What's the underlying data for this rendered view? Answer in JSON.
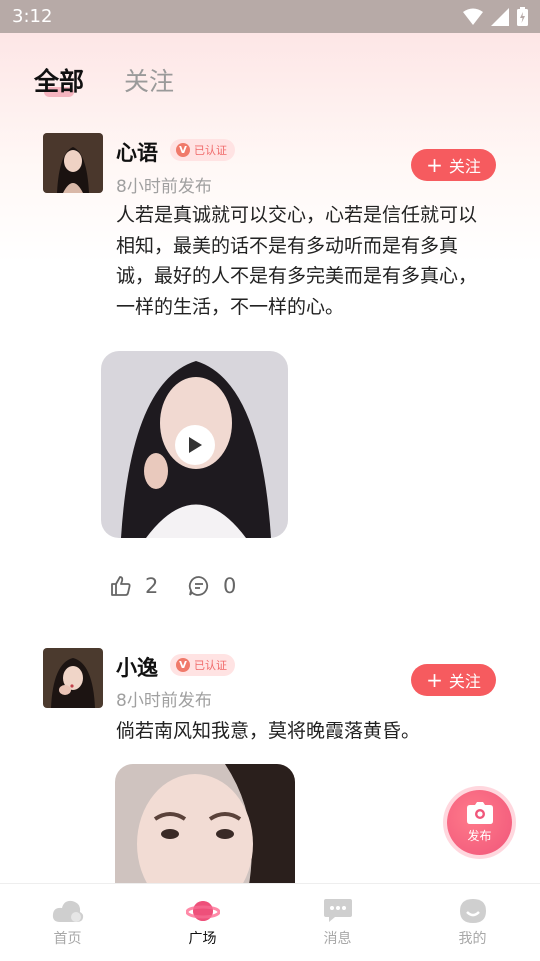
{
  "status_bar": {
    "time": "3:12"
  },
  "tabs": [
    {
      "label": "全部",
      "active": true
    },
    {
      "label": "关注",
      "active": false
    }
  ],
  "posts": [
    {
      "username": "心语",
      "badge": "已认证",
      "time": "8小时前发布",
      "follow_label": "关注",
      "content": "人若是真诚就可以交心，心若是信任就可以相知，最美的话不是有多动听而是有多真诚，最好的人不是有多完美而是有多真心，一样的生活，不一样的心。",
      "likes": "2",
      "comments": "0",
      "media_type": "video"
    },
    {
      "username": "小逸",
      "badge": "已认证",
      "time": "8小时前发布",
      "follow_label": "关注",
      "content": "倘若南风知我意，莫将晚霞落黄昏。",
      "media_type": "image"
    }
  ],
  "fab": {
    "label": "发布"
  },
  "bottom_nav": [
    {
      "label": "首页",
      "active": false
    },
    {
      "label": "广场",
      "active": true
    },
    {
      "label": "消息",
      "active": false
    },
    {
      "label": "我的",
      "active": false
    }
  ],
  "colors": {
    "accent": "#f65b5f",
    "active_tab_underline": "#f3a9b6",
    "status_bar": "#b7aaa7"
  }
}
